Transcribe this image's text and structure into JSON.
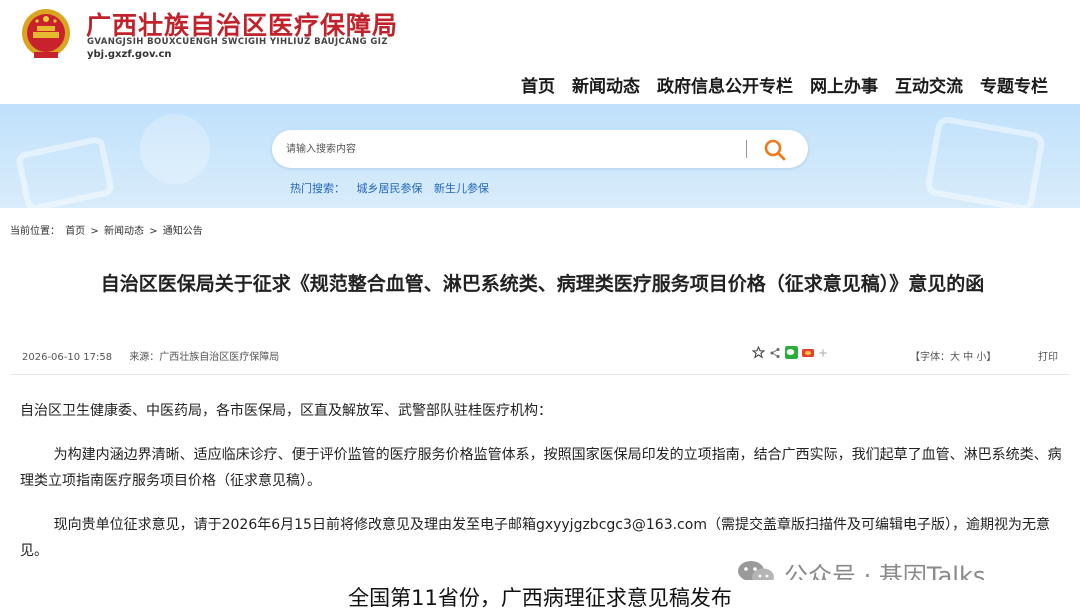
{
  "header": {
    "site_name_cn": "广西壮族自治区医疗保障局",
    "site_name_en": "GVANGJSIH BOUXCUENGH SWCIGIH YIHLIUZ BAUJCANG GIZ",
    "domain": "ybj.gxzf.gov.cn",
    "nav": [
      "首页",
      "新闻动态",
      "政府信息公开专栏",
      "网上办事",
      "互动交流",
      "专题专栏"
    ]
  },
  "search": {
    "placeholder": "请输入搜索内容",
    "hot_label": "热门搜索：",
    "hot_terms": [
      "城乡居民参保",
      "新生儿参保"
    ]
  },
  "breadcrumb": {
    "label": "当前位置：",
    "items": [
      "首页",
      "新闻动态",
      "通知公告"
    ],
    "separator": ">"
  },
  "article": {
    "title": "自治区医保局关于征求《规范整合血管、淋巴系统类、病理类医疗服务项目价格（征求意见稿）》意见的函",
    "datetime": "2026-06-10 17:58",
    "source": "来源：广西壮族自治区医疗保障局",
    "font_size_label": "【字体：大 中 小】",
    "print_label": "打印",
    "paragraphs": [
      "自治区卫生健康委、中医药局，各市医保局，区直及解放军、武警部队驻桂医疗机构：",
      "为构建内涵边界清晰、适应临床诊疗、便于评价监管的医疗服务价格监管体系，按照国家医保局印发的立项指南，结合广西实际，我们起草了血管、淋巴系统类、病理类立项指南医疗服务项目价格（征求意见稿）。",
      "现向贵单位征求意见，请于2026年6月15日前将修改意见及理由发至电子邮箱gxyyjgzbcgc3@163.com（需提交盖章版扫描件及可编辑电子版），逾期视为无意见。"
    ]
  },
  "watermark": "公众号 · 基因Talks",
  "caption": "全国第11省份，广西病理征求意见稿发布",
  "colors": {
    "brand_red": "#c0232b",
    "link_blue": "#2267b8",
    "search_orange": "#f07a1e",
    "banner_blue": "#cde7fb"
  },
  "icons": [
    "national-emblem-icon",
    "search-icon",
    "favorite-icon",
    "share-icon",
    "wechat-icon",
    "weibo-icon",
    "plus-icon",
    "wechat-watermark-icon"
  ]
}
